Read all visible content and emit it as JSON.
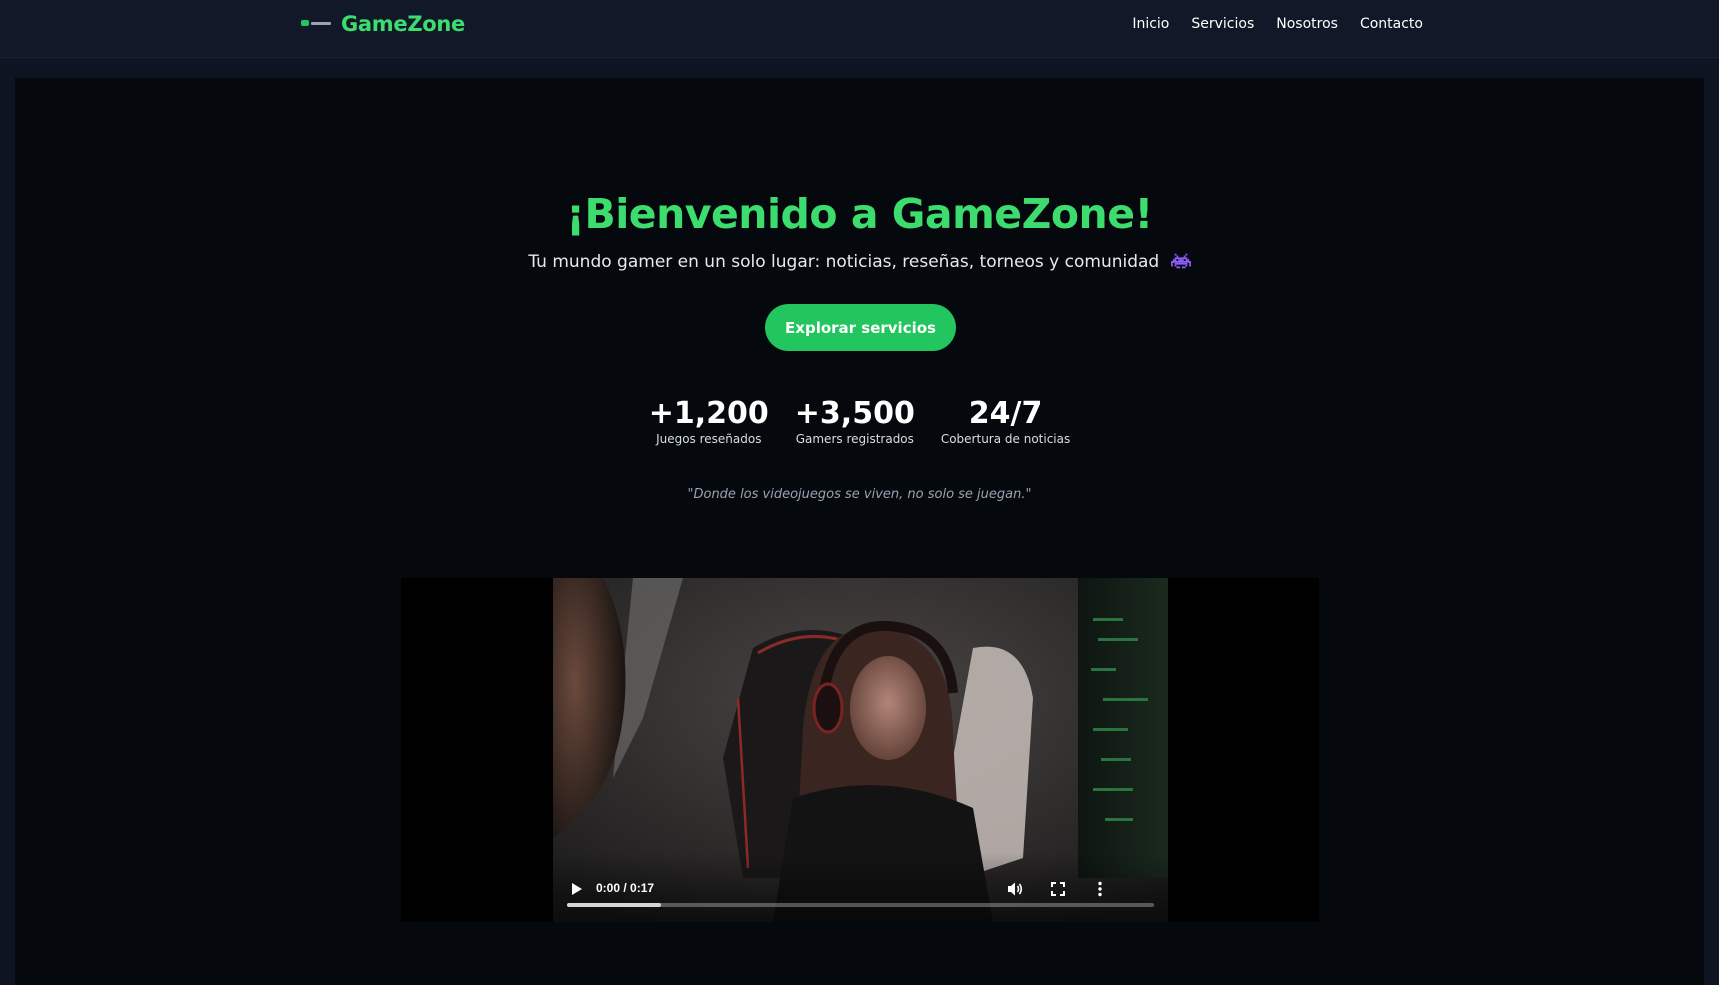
{
  "header": {
    "brand_name": "GameZone",
    "nav": [
      "Inicio",
      "Servicios",
      "Nosotros",
      "Contacto"
    ]
  },
  "hero": {
    "title": "¡Bienvenido a GameZone!",
    "subtitle": "Tu mundo gamer en un solo lugar: noticias, reseñas, torneos y comunidad",
    "subtitle_icon": "alien-monster-icon",
    "cta_label": "Explorar servicios",
    "stats": [
      {
        "value": "+1,200",
        "label": "Juegos reseñados"
      },
      {
        "value": "+3,500",
        "label": "Gamers registrados"
      },
      {
        "value": "24/7",
        "label": "Cobertura de noticias"
      }
    ],
    "quote": "\"Donde los videojuegos se viven, no solo se juegan.\""
  },
  "video": {
    "time": "0:00 / 0:17",
    "buffered_fraction": 0.16,
    "controls": [
      "play-icon",
      "volume-icon",
      "fullscreen-icon",
      "more-options-icon"
    ]
  },
  "colors": {
    "accent": "#22c55e",
    "brand_text": "#3ddc6f",
    "nav_bg": "#111827",
    "hero_bg": "#05080d"
  }
}
